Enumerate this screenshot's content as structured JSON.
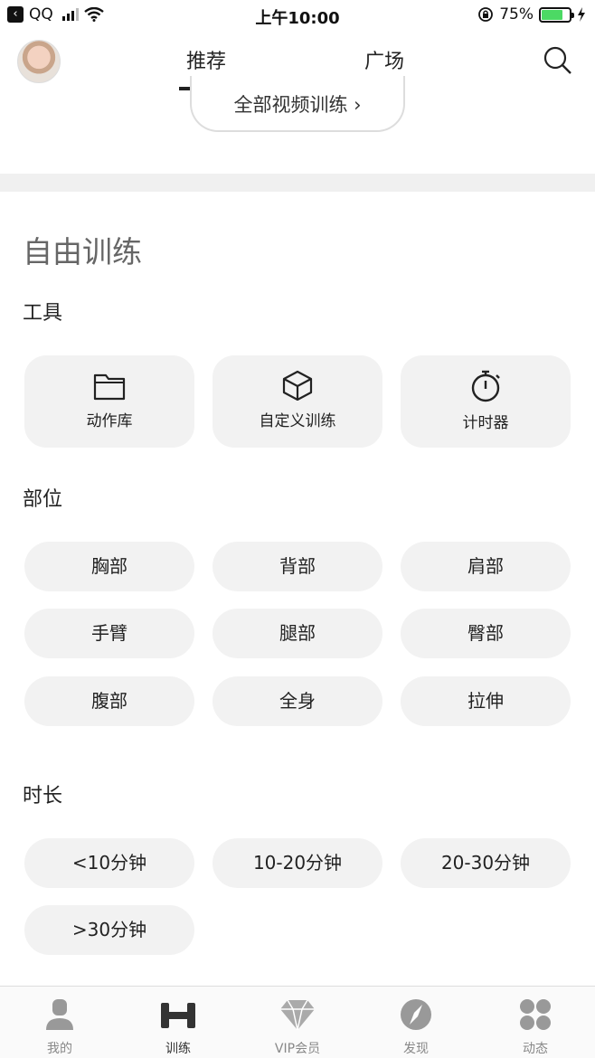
{
  "status_bar": {
    "app": "QQ",
    "time": "上午10:00",
    "battery": "75%",
    "battery_level": 0.75,
    "battery_color": "#4cd964"
  },
  "header": {
    "tabs": [
      {
        "label": "推荐",
        "active": true
      },
      {
        "label": "广场",
        "active": false
      }
    ],
    "search_icon": "search-icon",
    "avatar": "avatar"
  },
  "all_videos": {
    "label": "全部视频训练 ›"
  },
  "free_training": {
    "title": "自由训练",
    "tools": {
      "label": "工具",
      "items": [
        {
          "label": "动作库",
          "icon": "folder-icon"
        },
        {
          "label": "自定义训练",
          "icon": "cube-icon"
        },
        {
          "label": "计时器",
          "icon": "stopwatch-icon"
        }
      ]
    },
    "body_parts": {
      "label": "部位",
      "items": [
        "胸部",
        "背部",
        "肩部",
        "手臂",
        "腿部",
        "臀部",
        "腹部",
        "全身",
        "拉伸"
      ]
    },
    "duration": {
      "label": "时长",
      "items": [
        "<10分钟",
        "10-20分钟",
        "20-30分钟",
        ">30分钟"
      ]
    }
  },
  "bottom_nav": [
    {
      "label": "我的",
      "icon": "person-icon",
      "active": false
    },
    {
      "label": "训练",
      "icon": "dumbbell-icon",
      "active": true
    },
    {
      "label": "VIP会员",
      "icon": "diamond-icon",
      "active": false
    },
    {
      "label": "发现",
      "icon": "compass-icon",
      "active": false
    },
    {
      "label": "动态",
      "icon": "grid-dots-icon",
      "active": false
    }
  ]
}
